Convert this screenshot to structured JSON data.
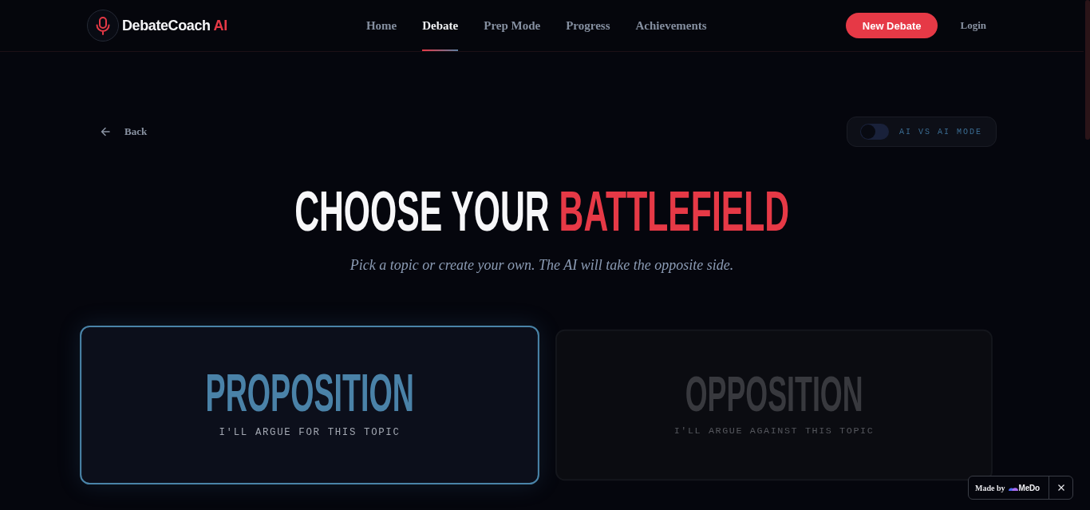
{
  "header": {
    "logo": {
      "name": "DebateCoach",
      "suffix": "AI"
    },
    "nav": [
      {
        "label": "Home",
        "selected": false
      },
      {
        "label": "Debate",
        "selected": true
      },
      {
        "label": "Prep Mode",
        "selected": false
      },
      {
        "label": "Progress",
        "selected": false
      },
      {
        "label": "Achievements",
        "selected": false
      }
    ],
    "new_debate_button": "New Debate",
    "login": "Login"
  },
  "toolbar": {
    "back": "Back",
    "ai_vs_ai_toggle": {
      "label": "AI VS AI MODE",
      "on": false
    }
  },
  "hero": {
    "title": "CHOOSE YOUR",
    "title_highlight": "BATTLEFIELD",
    "subtitle": "Pick a topic or create your own. The AI will take the opposite side."
  },
  "sides": [
    {
      "title": "PROPOSITION",
      "description": "I'LL ARGUE FOR THIS TOPIC",
      "selected": true
    },
    {
      "title": "OPPOSITION",
      "description": "I'LL ARGUE AGAINST THIS TOPIC",
      "selected": false
    }
  ],
  "badge": {
    "label": "Made by",
    "brand": "MeDo"
  }
}
